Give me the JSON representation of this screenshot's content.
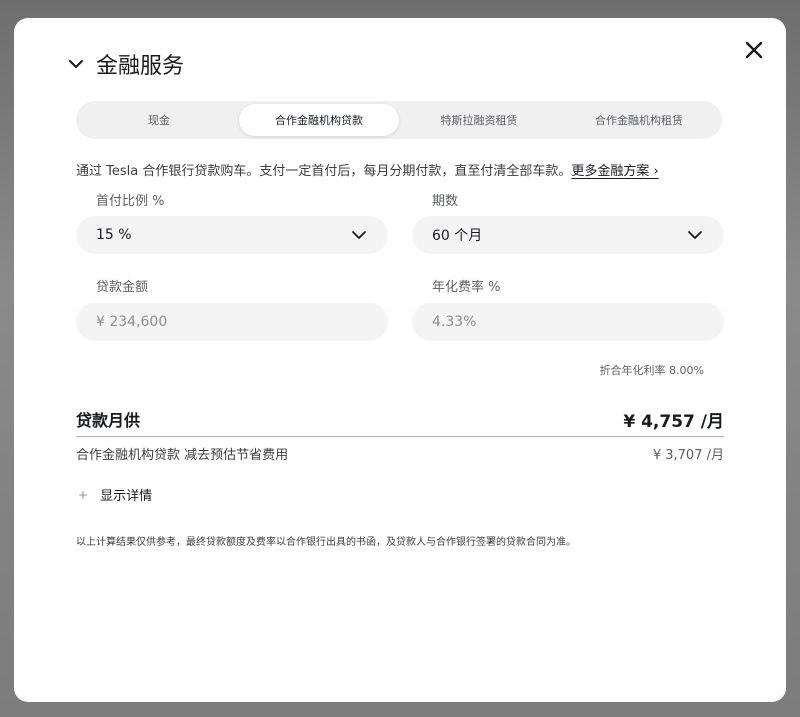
{
  "modal": {
    "title": "金融服务"
  },
  "tabs": [
    {
      "label": "现金",
      "active": false
    },
    {
      "label": "合作金融机构贷款",
      "active": true
    },
    {
      "label": "特斯拉融资租赁",
      "active": false
    },
    {
      "label": "合作金融机构租赁",
      "active": false
    }
  ],
  "description": {
    "text": "通过 Tesla 合作银行贷款购车。支付一定首付后，每月分期付款，直至付清全部车款。",
    "link": "更多金融方案 ›"
  },
  "fields": {
    "down_payment": {
      "label": "首付比例 %",
      "value": "15 %"
    },
    "term": {
      "label": "期数",
      "value": "60 个月"
    },
    "loan_amount": {
      "label": "贷款金额",
      "value": "¥ 234,600"
    },
    "rate": {
      "label": "年化费率 %",
      "value": "4.33%"
    }
  },
  "effective_rate": "折合年化利率 8.00%",
  "monthly": {
    "label": "贷款月供",
    "value": "¥ 4,757 /月"
  },
  "savings": {
    "label": "合作金融机构贷款 减去预估节省费用",
    "value": "¥ 3,707 /月"
  },
  "details": {
    "plus": "+",
    "label": "显示详情"
  },
  "disclaimer": "以上计算结果仅供参考，最终贷款额度及费率以合作银行出具的书函，及贷款人与合作银行签署的贷款合同为准。",
  "icons": {
    "close": "close-icon",
    "toggle": "chevron-down-icon",
    "select": "chevron-down-icon"
  },
  "colors": {
    "text": "#171a20",
    "muted": "#5c5e62",
    "field_bg": "#f4f4f4",
    "tab_bg": "#f0f0f0"
  }
}
